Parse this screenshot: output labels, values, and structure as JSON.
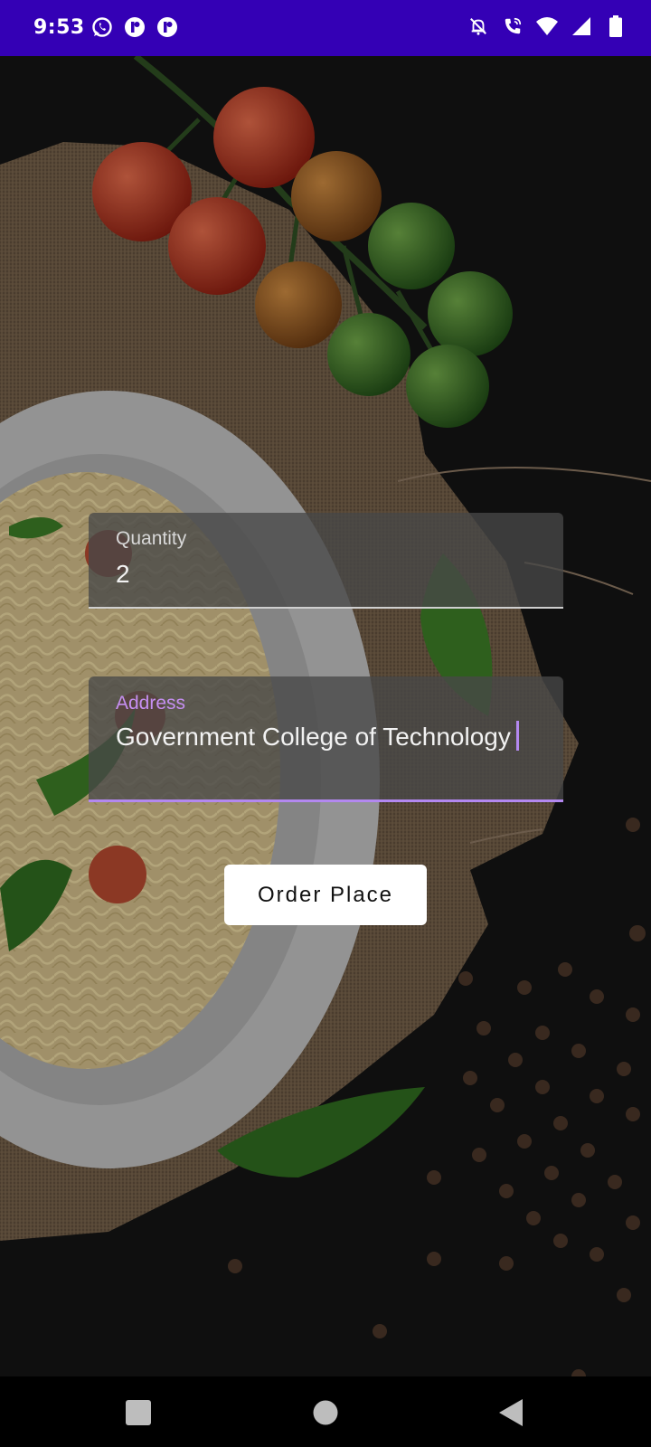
{
  "status_bar": {
    "time": "9:53",
    "left_icons": [
      "whatsapp-icon",
      "app-badge-icon",
      "app-badge-icon"
    ],
    "right_icons": [
      "notifications-off-icon",
      "wifi-calling-icon",
      "wifi-icon",
      "signal-icon",
      "battery-icon"
    ],
    "background": "#3400b5"
  },
  "form": {
    "quantity": {
      "label": "Quantity",
      "value": "2"
    },
    "address": {
      "label": "Address",
      "value": "Government College of Technology"
    },
    "accent_color": "#b388f0"
  },
  "order_button": {
    "label": "Order Place"
  },
  "nav_bar": {
    "buttons": [
      "recents-icon",
      "home-icon",
      "back-icon"
    ]
  }
}
